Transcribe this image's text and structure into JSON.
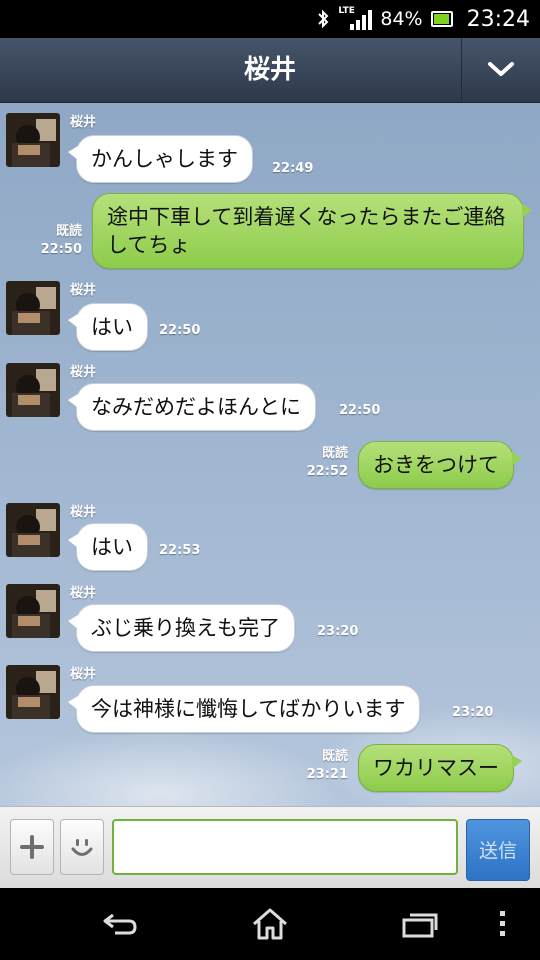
{
  "status_bar": {
    "network": "LTE",
    "battery_pct": "84%",
    "time": "23:24"
  },
  "header": {
    "title": "桜井"
  },
  "messages": [
    {
      "sender": "桜井",
      "text": "かんしゃします",
      "time": "22:49"
    },
    {
      "read": "既読",
      "time": "22:50",
      "text": "途中下車して到着遅くなったらまたご連絡してちょ"
    },
    {
      "sender": "桜井",
      "text": "はい",
      "time": "22:50"
    },
    {
      "sender": "桜井",
      "text": "なみだめだよほんとに",
      "time": "22:50"
    },
    {
      "read": "既読",
      "time": "22:52",
      "text": "おきをつけて"
    },
    {
      "sender": "桜井",
      "text": "はい",
      "time": "22:53"
    },
    {
      "sender": "桜井",
      "text": "ぶじ乗り換えも完了",
      "time": "23:20"
    },
    {
      "sender": "桜井",
      "text": "今は神様に懺悔してばかりいます",
      "time": "23:20"
    },
    {
      "read": "既読",
      "time": "23:21",
      "text": "ワカリマスー"
    }
  ],
  "input_bar": {
    "placeholder": "",
    "send_label": "送信"
  },
  "colors": {
    "header": "#3a4659",
    "outgoing_bubble": "#9ad15a",
    "incoming_bubble": "#ffffff",
    "send_button": "#3d85d2",
    "input_border": "#6fb23c"
  }
}
